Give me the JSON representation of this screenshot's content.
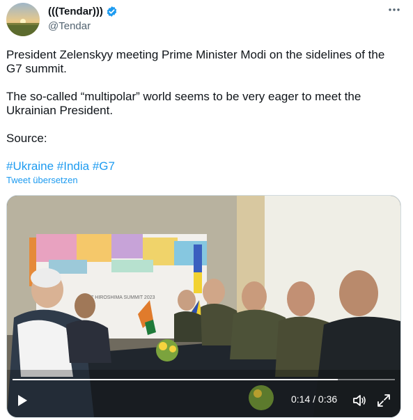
{
  "author": {
    "display_name": "(((Tendar)))",
    "handle": "@Tendar",
    "verified": true
  },
  "more_icon": "more-horizontal-icon",
  "tweet": {
    "paragraph_1": "President Zelenskyy meeting Prime Minister Modi on the sidelines of the G7 summit.",
    "paragraph_2": "The so-called “multipolar” world seems to be very eager to meet the Ukrainian President.",
    "paragraph_3": "Source:",
    "hashtags": [
      "#Ukraine",
      "#India",
      "#G7"
    ],
    "translate_label": "Tweet übersetzen"
  },
  "video": {
    "backdrop_text": "G7 HIROSHIMA SUMMIT 2023",
    "current_time": "0:14",
    "separator": " / ",
    "duration": "0:36",
    "progress": 0.85
  },
  "colors": {
    "link": "#1d9bf0",
    "text": "#0f1419",
    "secondary": "#536471",
    "verified": "#1d9bf0"
  }
}
